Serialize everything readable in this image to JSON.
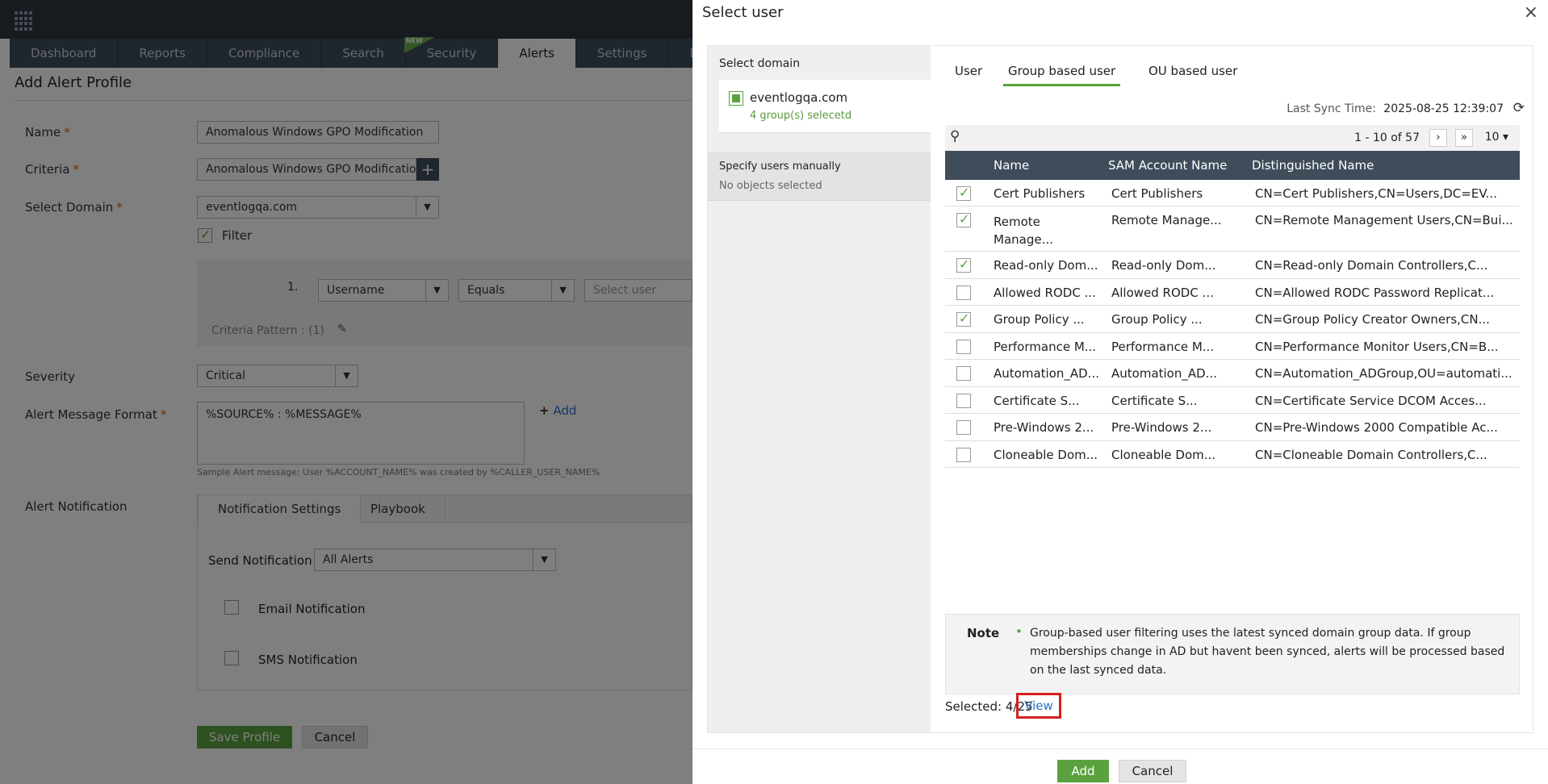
{
  "nav": {
    "tabs": [
      "Dashboard",
      "Reports",
      "Compliance",
      "Search",
      "Security",
      "Alerts",
      "Settings",
      "LogMe"
    ],
    "new_badge": "NEW"
  },
  "form": {
    "page_title": "Add Alert Profile",
    "name_label": "Name",
    "name_value": "Anomalous Windows GPO Modification",
    "criteria_label": "Criteria",
    "criteria_value": "Anomalous Windows GPO Modificatio",
    "domain_label": "Select Domain",
    "domain_value": "eventlogqa.com",
    "filter_label": "Filter",
    "row_number": "1.",
    "field_value": "Username",
    "operator_value": "Equals",
    "select_user_placeholder": "Select user",
    "criteria_pattern": "Criteria Pattern : (1)",
    "severity_label": "Severity",
    "severity_value": "Critical",
    "message_label": "Alert Message Format",
    "message_value": "%SOURCE% : %MESSAGE%",
    "add_link": "Add",
    "sample_message": "Sample Alert message: User %ACCOUNT_NAME% was created by %CALLER_USER_NAME%",
    "notification_label": "Alert Notification",
    "notif_tab_settings": "Notification Settings",
    "notif_tab_playbook": "Playbook",
    "send_notification_label": "Send Notification",
    "send_notification_value": "All Alerts",
    "email_label": "Email Notification",
    "sms_label": "SMS Notification",
    "save_label": "Save Profile",
    "cancel_label": "Cancel"
  },
  "modal": {
    "title": "Select user",
    "close": "×",
    "select_domain_label": "Select domain",
    "domain_name": "eventlogqa.com",
    "domain_count": "4 group(s) selecetd",
    "manual_title": "Specify users manually",
    "manual_sub": "No objects selected",
    "tabs": [
      "User",
      "Group based user",
      "OU based user"
    ],
    "sync_label": "Last Sync Time:",
    "sync_value": "2025-08-25 12:39:07",
    "page_info": "1 - 10 of 57",
    "per_page": "10",
    "columns": [
      "Name",
      "SAM Account Name",
      "Distinguished Name"
    ],
    "rows": [
      {
        "checked": true,
        "name": "Cert Publishers",
        "sam": "Cert Publishers",
        "dn": "CN=Cert Publishers,CN=Users,DC=EV..."
      },
      {
        "checked": true,
        "name": "Remote Manage...",
        "sam": "Remote Manage...",
        "dn": "CN=Remote Management Users,CN=Bui..."
      },
      {
        "checked": true,
        "name": "Read-only Dom...",
        "sam": "Read-only Dom...",
        "dn": "CN=Read-only Domain Controllers,C..."
      },
      {
        "checked": false,
        "name": "Allowed RODC ...",
        "sam": "Allowed RODC ...",
        "dn": "CN=Allowed RODC Password Replicat..."
      },
      {
        "checked": true,
        "name": "Group Policy ...",
        "sam": "Group Policy ...",
        "dn": "CN=Group Policy Creator Owners,CN..."
      },
      {
        "checked": false,
        "name": "Performance M...",
        "sam": "Performance M...",
        "dn": "CN=Performance Monitor Users,CN=B..."
      },
      {
        "checked": false,
        "name": "Automation_AD...",
        "sam": "Automation_AD...",
        "dn": "CN=Automation_ADGroup,OU=automati..."
      },
      {
        "checked": false,
        "name": "Certificate S...",
        "sam": "Certificate S...",
        "dn": "CN=Certificate Service DCOM Acces..."
      },
      {
        "checked": false,
        "name": "Pre-Windows 2...",
        "sam": "Pre-Windows 2...",
        "dn": "CN=Pre-Windows 2000 Compatible Ac..."
      },
      {
        "checked": false,
        "name": "Cloneable Dom...",
        "sam": "Cloneable Dom...",
        "dn": "CN=Cloneable Domain Controllers,C..."
      }
    ],
    "note_title": "Note",
    "note_text": "Group-based user filtering uses the latest synced domain group data. If group memberships change in AD but havent been synced, alerts will be processed based on the last synced data.",
    "selected_text": "Selected: 4/25",
    "view_link": "View",
    "add_button": "Add",
    "cancel_button": "Cancel"
  },
  "icons": {
    "next": "next-page-icon",
    "last": "last-page-icon",
    "refresh": "refresh-icon",
    "search": "search-icon"
  },
  "colors": {
    "accent_green": "#5aa23f",
    "nav_dark": "#3f4c5a",
    "highlight_red": "#d42020",
    "link_blue": "#2a73c7"
  }
}
